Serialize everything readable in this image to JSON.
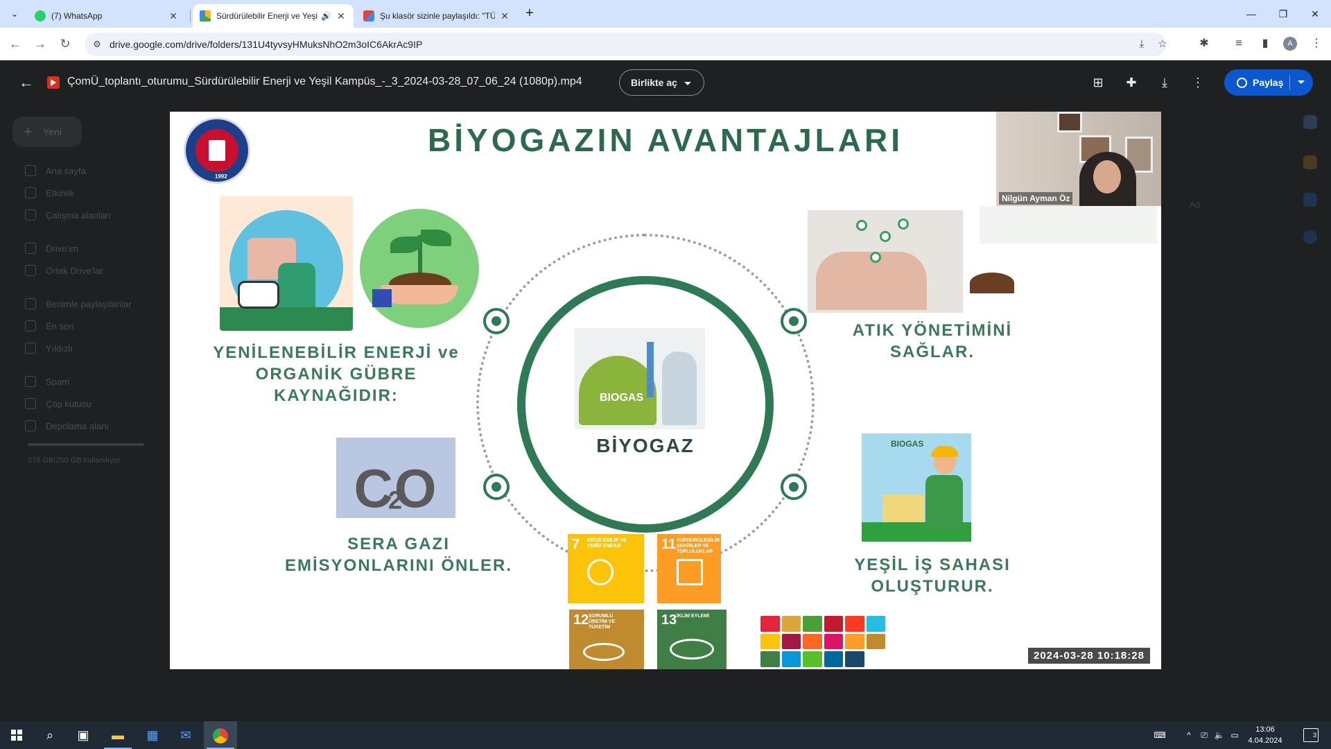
{
  "browser": {
    "tabs": [
      {
        "title": "(7) WhatsApp",
        "icon": "whatsapp-icon",
        "active": false
      },
      {
        "title": "Sürdürülebilir Enerji ve Yeşi",
        "icon": "google-drive-icon",
        "active": true,
        "audio": true
      },
      {
        "title": "Şu klasör sizinle paylaşıldı: \"TÜE",
        "icon": "gmail-icon",
        "active": false
      }
    ],
    "new_tab_symbol": "+",
    "url": "drive.google.com/drive/folders/131U4tyvsyHMuksNhO2m3oIC6AkrAc9IP",
    "profile_initial": "A"
  },
  "drive": {
    "new_label": "Yeni",
    "sidebar": [
      {
        "label": "Ana sayfa"
      },
      {
        "label": "Etkinlik"
      },
      {
        "label": "Çalışma alanları"
      },
      {
        "label": "Drive'ım"
      },
      {
        "label": "Ortak Drive'lar"
      },
      {
        "label": "Benimle paylaşılanlar"
      },
      {
        "label": "En son"
      },
      {
        "label": "Yıldızlı"
      },
      {
        "label": "Spam"
      },
      {
        "label": "Çöp kutusu"
      },
      {
        "label": "Depolama alanı"
      }
    ],
    "storage_text": "279 GB/250 GB kullanılıyor",
    "sort_label": "Ad"
  },
  "viewer": {
    "file_title": "ÇomÜ_toplantı_oturumu_Sürdürülebilir Enerji ve Yeşil Kampüs_-_3_2024-03-28_07_06_24 (1080p).mp4",
    "open_with_label": "Birlikte aç",
    "share_label": "Paylaş"
  },
  "slide": {
    "title": "BİYOGAZIN AVANTAJLARI",
    "logo_year": "1992",
    "center_label": "BİYOGAZ",
    "biogas_image_text": "BIOGAS",
    "worker_image_text": "BIOGAS",
    "co2_text": "CO",
    "co2_sub": "2",
    "benefit_left_top": [
      "YENİLENEBİLİR ENERJİ ve",
      "ORGANİK GÜBRE",
      "KAYNAĞIDIR:"
    ],
    "benefit_right_top": [
      "ATIK YÖNETİMİNİ",
      "SAĞLAR."
    ],
    "benefit_left_bottom": [
      "SERA GAZI",
      "EMİSYONLARINI ÖNLER."
    ],
    "benefit_right_bottom": [
      "YEŞİL İŞ SAHASI",
      "OLUŞTURUR."
    ],
    "sdg_tiles": [
      {
        "num": "7",
        "label": "ERİŞİLEBİLİR VE TEMİZ ENERJİ",
        "color": "#fcc30b"
      },
      {
        "num": "11",
        "label": "SÜRDÜRÜLEBİLİR ŞEHİRLER VE TOPLULUKLAR",
        "color": "#fd9d24"
      },
      {
        "num": "12",
        "label": "SORUMLU ÜRETİM VE TÜKETİM",
        "color": "#bf8b2e"
      },
      {
        "num": "13",
        "label": "İKLİM EYLEMİ",
        "color": "#3f7e44"
      }
    ],
    "sdg_grid_colors": [
      "#e5243b",
      "#dda63a",
      "#4c9f38",
      "#c5192d",
      "#ff3a21",
      "#26bde2",
      "#fcc30b",
      "#a21942",
      "#fd6925",
      "#dd1367",
      "#fd9d24",
      "#bf8b2e",
      "#3f7e44",
      "#0a97d9",
      "#56c02b",
      "#00689d",
      "#19486a",
      "#ffffff"
    ]
  },
  "webcam": {
    "participant_name": "Nilgün Ayman Öz"
  },
  "video": {
    "timestamp": "2024-03-28  10:18:28"
  },
  "taskbar": {
    "time": "13:06",
    "date": "4.04.2024",
    "notifications": "3"
  }
}
